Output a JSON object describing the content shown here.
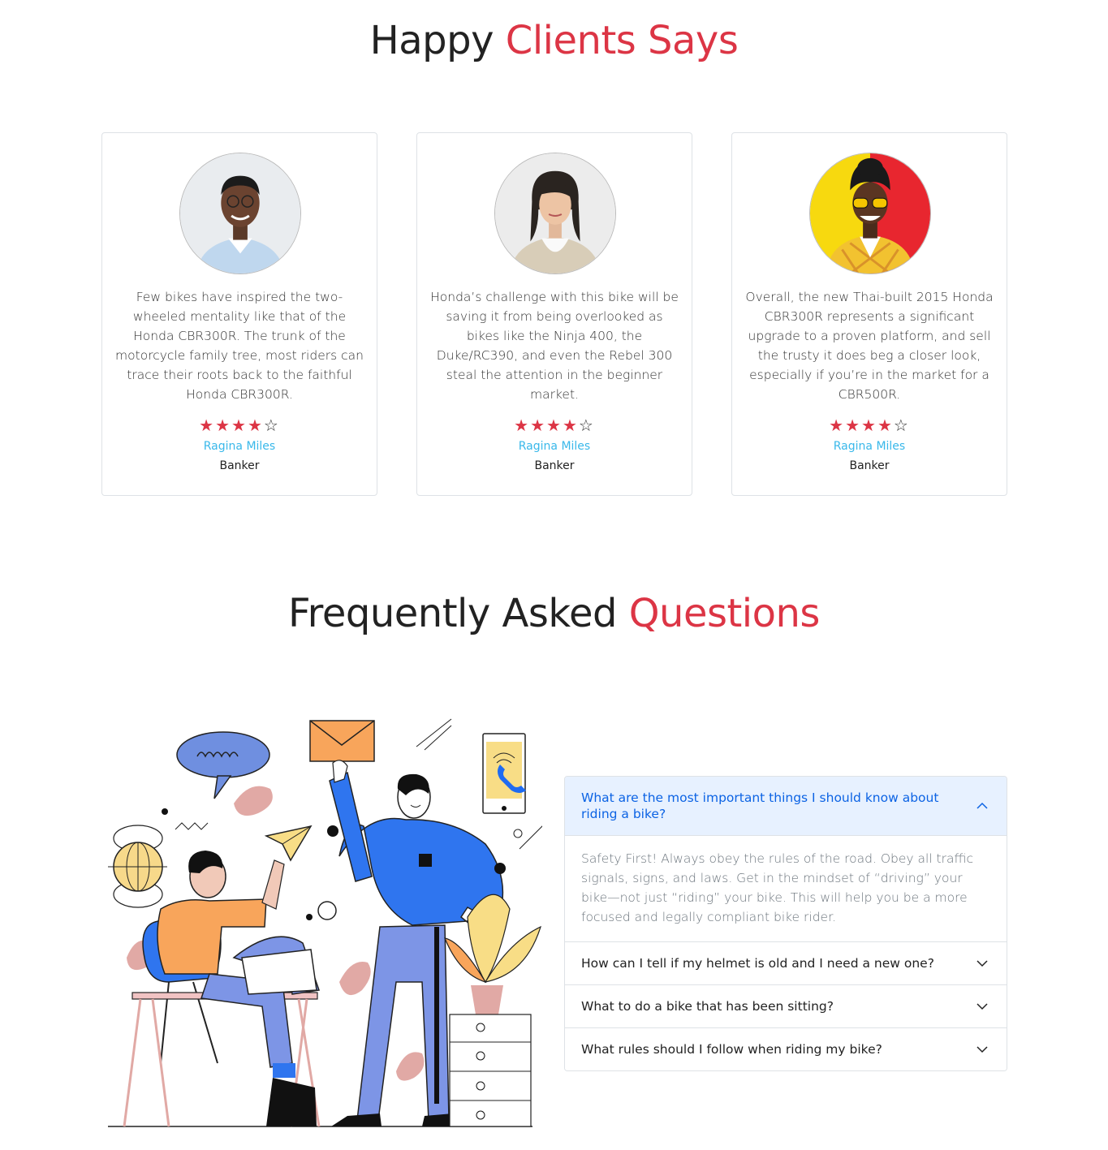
{
  "testimonials": {
    "title_part1": "Happy",
    "title_part2": "Clients Says",
    "cards": [
      {
        "quote": "Few bikes have inspired the two-wheeled mentality like that of the Honda CBR300R. The trunk of the motorcycle family tree, most riders can trace their roots back to the faithful Honda CBR300R.",
        "rating": 4,
        "rating_max": 5,
        "name": "Ragina Miles",
        "role": "Banker"
      },
      {
        "quote": "Honda’s challenge with this bike will be saving it from being overlooked as bikes like the Ninja 400, the Duke/RC390, and even the Rebel 300 steal the attention in the beginner market.",
        "rating": 4,
        "rating_max": 5,
        "name": "Ragina Miles",
        "role": "Banker"
      },
      {
        "quote": "Overall, the new Thai-built 2015 Honda CBR300R represents a significant upgrade to a proven platform, and sell the trusty it does beg a closer look, especially if you’re in the market for a CBR500R.",
        "rating": 4,
        "rating_max": 5,
        "name": "Ragina Miles",
        "role": "Banker"
      }
    ]
  },
  "faq": {
    "title_part1": "Frequently Asked",
    "title_part2": "Questions",
    "items": [
      {
        "question": "What are the most important things I should know about riding a bike?",
        "answer": "Safety First! Always obey the rules of the road. Obey all traffic signals, signs, and laws. Get in the mindset of “driving” your bike—not just “riding” your bike. This will help you be a more focused and legally compliant bike rider.",
        "expanded": true
      },
      {
        "question": "How can I tell if my helmet is old and I need a new one?",
        "expanded": false
      },
      {
        "question": "What to do a bike that has been sitting?",
        "expanded": false
      },
      {
        "question": "What rules should I follow when riding my bike?",
        "expanded": false
      }
    ]
  },
  "colors": {
    "accent_red": "#dc3545",
    "name_blue": "#39b8ea",
    "faq_active_bg": "#e7f1ff",
    "faq_active_text": "#0c63e4"
  },
  "icons": [
    "star-icon",
    "chevron-up-icon",
    "chevron-down-icon"
  ]
}
